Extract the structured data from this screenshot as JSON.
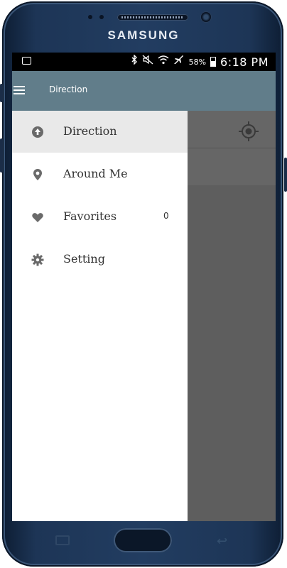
{
  "device": {
    "brand": "SAMSUNG"
  },
  "status_bar": {
    "battery_percent": "58%",
    "time": "6:18 PM",
    "icons": [
      "message-icon",
      "bluetooth-icon",
      "mute-icon",
      "wifi-icon",
      "airplane-icon",
      "battery-icon"
    ]
  },
  "app_bar": {
    "title": "Direction"
  },
  "drawer": {
    "items": [
      {
        "label": "Direction",
        "icon": "arrow-up-circle-icon",
        "active": true
      },
      {
        "label": "Around Me",
        "icon": "location-pin-icon"
      },
      {
        "label": "Favorites",
        "icon": "heart-icon",
        "count": "0"
      },
      {
        "label": "Setting",
        "icon": "gear-icon"
      }
    ]
  },
  "colors": {
    "app_bar": "#617d8a",
    "drawer_active": "#e9e9e9",
    "scrim": "#5e5e5e",
    "icon_gray": "#6a6a6a"
  }
}
